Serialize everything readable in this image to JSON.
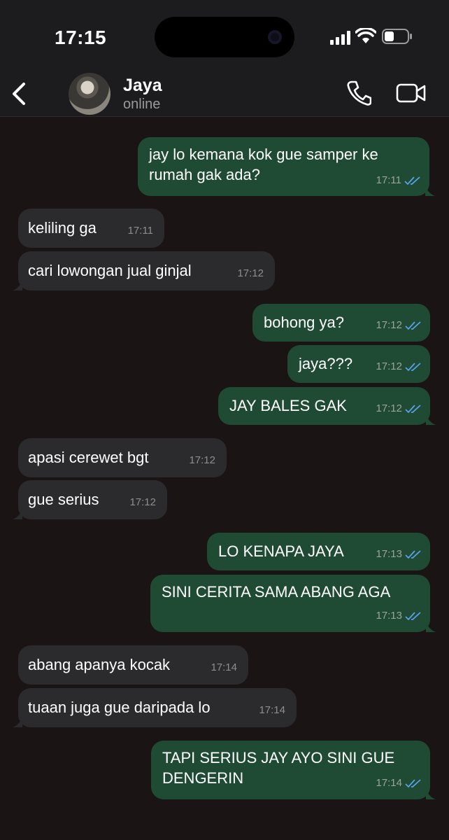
{
  "status": {
    "time": "17:15"
  },
  "contact": {
    "name": "Jaya",
    "presence": "online"
  },
  "messages": [
    {
      "dir": "out",
      "text": "jay lo kemana kok gue samper ke rumah gak ada?",
      "time": "17:11",
      "read": true
    },
    {
      "dir": "in",
      "text": "keliling ga",
      "time": "17:11"
    },
    {
      "dir": "in",
      "text": "cari lowongan jual ginjal",
      "time": "17:12"
    },
    {
      "dir": "out",
      "text": "bohong ya?",
      "time": "17:12",
      "read": true
    },
    {
      "dir": "out",
      "text": "jaya???",
      "time": "17:12",
      "read": true
    },
    {
      "dir": "out",
      "text": "JAY BALES GAK",
      "time": "17:12",
      "read": true
    },
    {
      "dir": "in",
      "text": "apasi cerewet bgt",
      "time": "17:12"
    },
    {
      "dir": "in",
      "text": "gue serius",
      "time": "17:12"
    },
    {
      "dir": "out",
      "text": "LO KENAPA JAYA",
      "time": "17:13",
      "read": true
    },
    {
      "dir": "out",
      "text": "SINI CERITA SAMA ABANG AGA",
      "time": "17:13",
      "read": true
    },
    {
      "dir": "in",
      "text": "abang apanya kocak",
      "time": "17:14"
    },
    {
      "dir": "in",
      "text": "tuaan juga gue daripada lo",
      "time": "17:14"
    },
    {
      "dir": "out",
      "text": "TAPI SERIUS JAY AYO SINI GUE DENGERIN",
      "time": "17:14",
      "read": true
    }
  ],
  "icons": {
    "back": "chevron-left-icon",
    "call": "phone-icon",
    "video": "video-camera-icon",
    "read": "double-check-icon"
  },
  "colors": {
    "incoming": "#2b2b2d",
    "outgoing": "#1f4b34",
    "read_ticks": "#5aa0e6",
    "background": "#1a1514"
  }
}
